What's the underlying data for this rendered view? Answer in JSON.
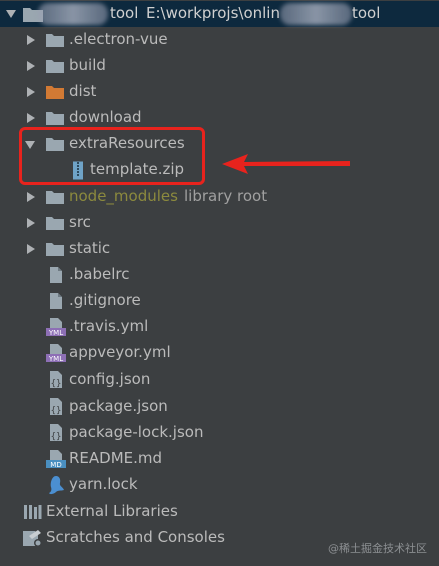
{
  "header": {
    "project_suffix": "tool",
    "path_start": "E:\\workprojs\\onlin",
    "path_end": "tool"
  },
  "tree": [
    {
      "label": "electron-vue",
      "kind": "folder",
      "display": ".electron-vue"
    },
    {
      "label": "build",
      "kind": "folder"
    },
    {
      "label": "dist",
      "kind": "folder-excluded"
    },
    {
      "label": "download",
      "kind": "folder"
    },
    {
      "label": "extraResources",
      "kind": "folder-open"
    },
    {
      "label": "template.zip",
      "kind": "zip"
    },
    {
      "label": "node_modules",
      "kind": "folder-library",
      "suffix": "library root"
    },
    {
      "label": "src",
      "kind": "folder"
    },
    {
      "label": "static",
      "kind": "folder"
    },
    {
      "label": ".babelrc",
      "kind": "file"
    },
    {
      "label": ".gitignore",
      "kind": "file"
    },
    {
      "label": ".travis.yml",
      "kind": "yml"
    },
    {
      "label": "appveyor.yml",
      "kind": "yml"
    },
    {
      "label": "config.json",
      "kind": "json"
    },
    {
      "label": "package.json",
      "kind": "json"
    },
    {
      "label": "package-lock.json",
      "kind": "json"
    },
    {
      "label": "README.md",
      "kind": "md"
    },
    {
      "label": "yarn.lock",
      "kind": "yarn"
    }
  ],
  "footer_items": [
    {
      "label": "External Libraries",
      "icon": "libraries-icon"
    },
    {
      "label": "Scratches and Consoles",
      "icon": "scratches-icon"
    }
  ],
  "watermark": "@稀土掘金技术社区",
  "colors": {
    "background": "#3c3f41",
    "text": "#bbbbbb",
    "excluded_folder": "#d4a247",
    "library_folder": "#8c8a3e",
    "annotation_red": "#e8231d"
  }
}
